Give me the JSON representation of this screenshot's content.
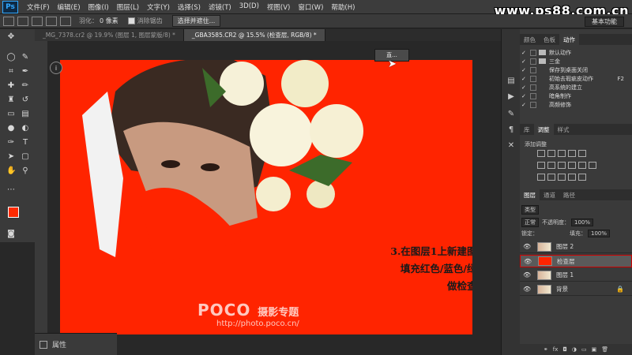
{
  "menu": {
    "logo": "Ps",
    "items": [
      "文件(F)",
      "编辑(E)",
      "图像(I)",
      "图层(L)",
      "文字(Y)",
      "选择(S)",
      "滤镜(T)",
      "3D(D)",
      "视图(V)",
      "窗口(W)",
      "帮助(H)"
    ]
  },
  "watermark": "www.ps88.com.cn",
  "options": {
    "feather_label": "羽化：",
    "feather_value": "0 像素",
    "antialias_label": "消除锯齿",
    "select_mask_button": "选择并遮住...",
    "workspace": "基本功能"
  },
  "tabs": [
    {
      "label": "_MG_7378.cr2 @ 19.9% (图层 1, 图层蒙版/8) *",
      "active": false
    },
    {
      "label": "_GBA3585.CR2 @ 15.5% (检查层, RGB/8) *",
      "active": true
    }
  ],
  "canvas": {
    "info_icon": "i",
    "float_panel_label": "直..."
  },
  "instruction": {
    "line1": "3.在图层1上新建图层",
    "line2": "填充红色/蓝色/绿色",
    "line3": "做检查层"
  },
  "poco": {
    "brand": "POCO",
    "title": "摄影专题",
    "url": "http://photo.poco.cn/"
  },
  "properties_panel": {
    "label": "属性"
  },
  "right_panel": {
    "top_tabs": [
      "颜色",
      "色板",
      "动作"
    ],
    "actions": [
      {
        "label": "默认动作",
        "type": "folder",
        "key": ""
      },
      {
        "label": "三金",
        "type": "folder",
        "key": ""
      },
      {
        "label": "保存到桌面关闭",
        "type": "item",
        "key": ""
      },
      {
        "label": "初始去瑕疵皮动作",
        "type": "item",
        "key": "F2"
      },
      {
        "label": "高系统的建立",
        "type": "item",
        "key": ""
      },
      {
        "label": "暗角制作",
        "type": "item",
        "key": ""
      },
      {
        "label": "高频修饰",
        "type": "item",
        "key": ""
      }
    ],
    "mid_tabs": [
      "库",
      "调整",
      "样式"
    ],
    "adjust_title": "添加调整",
    "layer_tabs": [
      "图层",
      "通道",
      "路径"
    ],
    "filter_type": "类型",
    "blend_mode": "正常",
    "opacity_label": "不透明度：",
    "opacity_value": "100%",
    "lock_label": "锁定：",
    "fill_label": "填充：",
    "fill_value": "100%",
    "layers": [
      {
        "name": "图层 2",
        "thumb": "photo",
        "selected": false
      },
      {
        "name": "检查层",
        "thumb": "red",
        "selected": true
      },
      {
        "name": "图层 1",
        "thumb": "photo",
        "selected": false
      },
      {
        "name": "背景",
        "thumb": "photo",
        "selected": false,
        "locked": true
      }
    ],
    "bottom_icons": [
      "co",
      "fx"
    ]
  },
  "colors": {
    "foreground": "#ff2a00",
    "background": "#ffffff",
    "canvas_fill": "#ff2400"
  }
}
